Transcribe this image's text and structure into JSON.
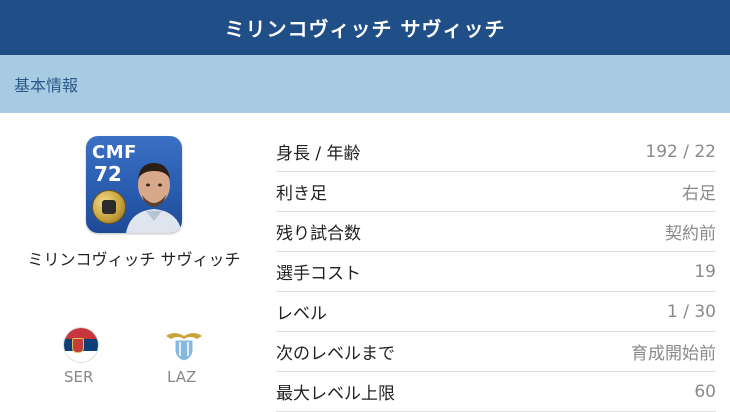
{
  "header": {
    "title": "ミリンコヴィッチ サヴィッチ"
  },
  "section": {
    "title": "基本情報"
  },
  "player": {
    "position": "CMF",
    "rating": "72",
    "name": "ミリンコヴィッチ サヴィッチ",
    "country": "SER",
    "club": "LAZ"
  },
  "stats": [
    {
      "label": "身長 / 年齢",
      "value": "192 / 22"
    },
    {
      "label": "利き足",
      "value": "右足"
    },
    {
      "label": "残り試合数",
      "value": "契約前"
    },
    {
      "label": "選手コスト",
      "value": "19"
    },
    {
      "label": "レベル",
      "value": "1 / 30"
    },
    {
      "label": "次のレベルまで",
      "value": "育成開始前"
    },
    {
      "label": "最大レベル上限",
      "value": "60"
    }
  ],
  "colors": {
    "header_bg": "#1f4f86",
    "section_bg": "#a7cbe3",
    "section_text": "#2b5a8a",
    "value_text": "#8a8a8a",
    "serbia_red": "#c6363c",
    "serbia_blue": "#0c4076",
    "serbia_white": "#ffffff",
    "lazio_sky": "#87b9e0"
  },
  "icons": {
    "player_badge": "gold-medal-icon",
    "country_flag": "serbia-flag-icon",
    "club_crest": "lazio-crest-icon"
  }
}
